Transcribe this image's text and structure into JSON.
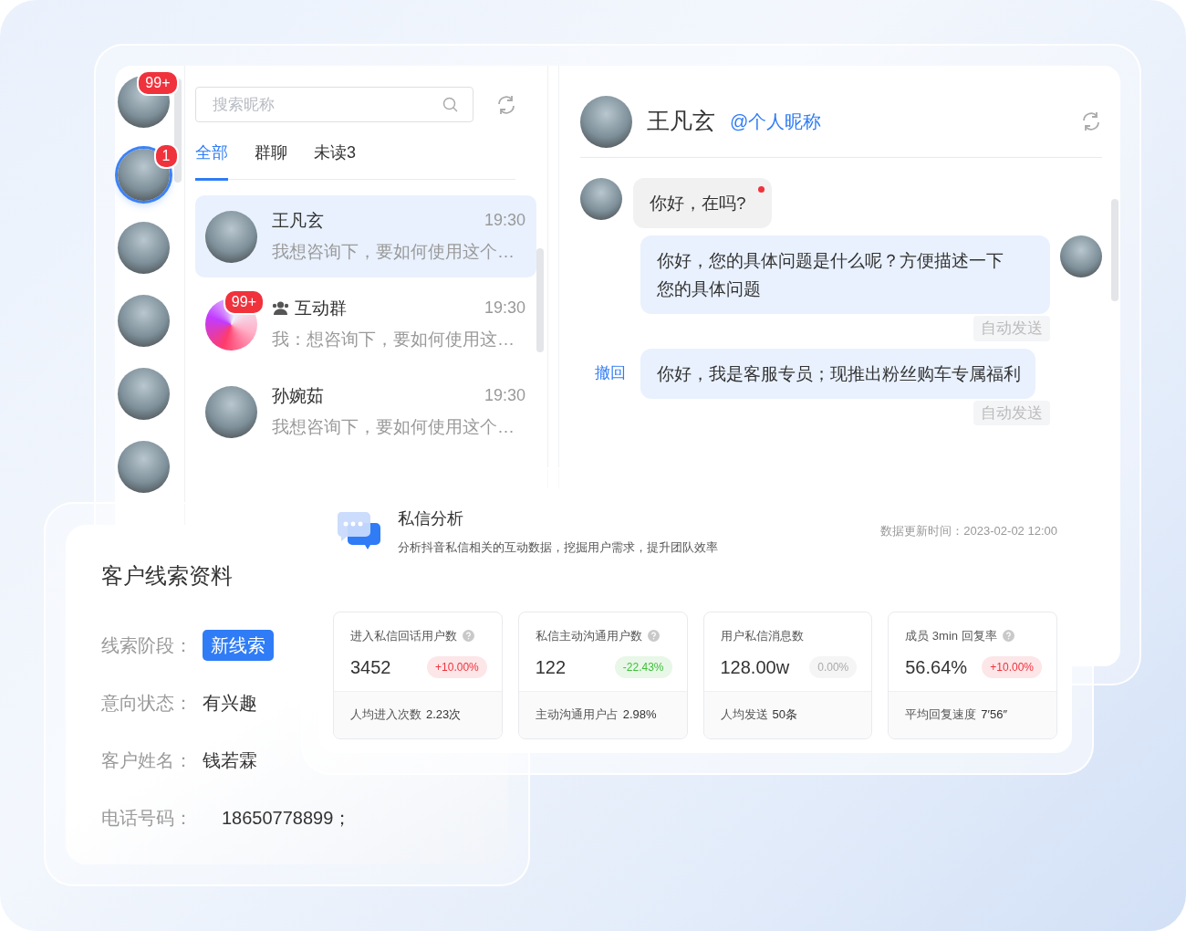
{
  "rail": {
    "avatars": [
      {
        "badge": "99+",
        "selected": false
      },
      {
        "badge": "1",
        "selected": true
      },
      {
        "selected": false
      },
      {
        "selected": false
      },
      {
        "selected": false
      },
      {
        "selected": false
      }
    ]
  },
  "search": {
    "placeholder": "搜索昵称"
  },
  "tabs": [
    {
      "label": "全部",
      "selected": true
    },
    {
      "label": "群聊",
      "selected": false
    },
    {
      "label": "未读3",
      "selected": false
    }
  ],
  "conversations": [
    {
      "kind": "person",
      "name": "王凡玄",
      "time": "19:30",
      "preview": "我想咨询下，要如何使用这个…",
      "selected": true
    },
    {
      "kind": "group",
      "name": "互动群",
      "badge": "99+",
      "time": "19:30",
      "preview": "我：想咨询下，要如何使用这…",
      "selected": false
    },
    {
      "kind": "person",
      "name": "孙婉茹",
      "time": "19:30",
      "preview": "我想咨询下，要如何使用这个…",
      "selected": false
    }
  ],
  "chat": {
    "name": "王凡玄",
    "handle": "@个人昵称",
    "messages": [
      {
        "kind": "incoming",
        "text": "你好，在吗?",
        "unread": true
      },
      {
        "kind": "outgoing",
        "text": "你好，您的具体问题是什么呢？方便描述一下您的具体问题",
        "avatar": true,
        "status": "自动发送"
      },
      {
        "kind": "outgoing",
        "text": "你好，我是客服专员；现推出粉丝购车专属福利",
        "action": "撤回",
        "status": "自动发送"
      }
    ]
  },
  "customer": {
    "title": "客户线索资料",
    "fields": [
      {
        "kind": "tag",
        "label": "线索阶段：",
        "value": "新线索"
      },
      {
        "kind": "text",
        "label": "意向状态：",
        "value": "有兴趣"
      },
      {
        "kind": "text",
        "label": "客户姓名：",
        "value": "钱若霖"
      },
      {
        "kind": "text",
        "label": "电话号码：",
        "value": "18650778899；"
      }
    ]
  },
  "analytics": {
    "title": "私信分析",
    "subtitle": "分析抖音私信相关的互动数据，挖掘用户需求，提升团队效率",
    "updated": "数据更新时间：2023-02-02 12:00",
    "metrics": [
      {
        "label": "进入私信回话用户数",
        "help": true,
        "value": "3452",
        "change": "+10.00%",
        "color": "#f0323c",
        "footer_label": "人均进入次数",
        "footer_value": "2.23次"
      },
      {
        "label": "私信主动沟通用户数",
        "help": true,
        "value": "122",
        "change": "-22.43%",
        "color": "#3fbf3a",
        "footer_label": "主动沟通用户占",
        "footer_value": "2.98%"
      },
      {
        "label": "用户私信消息数",
        "help": false,
        "value": "128.00w",
        "change": "0.00%",
        "color": "#aaaaaa",
        "footer_label": "人均发送",
        "footer_value": "50条"
      },
      {
        "label": "成员 3min 回复率",
        "help": true,
        "value": "56.64%",
        "change": "+10.00%",
        "color": "#f0323c",
        "footer_label": "平均回复速度",
        "footer_value": "7′56″"
      }
    ]
  }
}
